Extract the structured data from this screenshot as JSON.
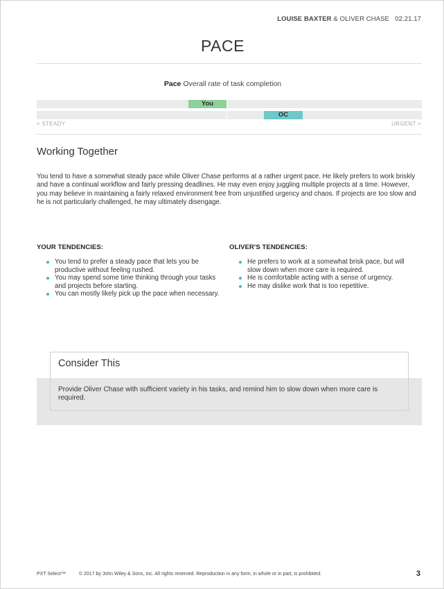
{
  "header": {
    "names_bold": "LOUISE BAXTER",
    "names_rest": "& OLIVER CHASE",
    "date": "02.21.17"
  },
  "page_title": "PACE",
  "scale": {
    "title_strong": "Pace",
    "title_rest": "Overall rate of task completion",
    "markers": [
      {
        "label": "You",
        "color": "#8fd19a"
      },
      {
        "label": "OC",
        "color": "#6ec8c8"
      }
    ],
    "left_label": "< STEADY",
    "right_label": "URGENT >"
  },
  "working_together": {
    "heading": "Working Together",
    "paragraph": "You tend to have a somewhat steady pace while Oliver Chase performs at a rather urgent pace. He likely prefers to work briskly and have a continual workflow and fairly pressing deadlines. He may even enjoy juggling multiple projects at a time. However, you may believe in maintaining a fairly relaxed environment free from unjustified urgency and chaos. If projects are too slow and he is not particularly challenged, he may ultimately disengage."
  },
  "your_tendencies": {
    "heading": "YOUR TENDENCIES:",
    "items": [
      "You tend to prefer a steady pace that lets you be productive without feeling rushed.",
      "You may spend some time thinking through your tasks and projects before starting.",
      "You can mostly likely pick up the pace when necessary."
    ]
  },
  "olivers_tendencies": {
    "heading": "OLIVER'S TENDENCIES:",
    "items": [
      "He prefers to work at a somewhat brisk pace, but will slow down when more care is required.",
      "He is comfortable acting with a sense of urgency.",
      "He may dislike work that is too repetitive."
    ]
  },
  "consider": {
    "title": "Consider This",
    "text": "Provide Oliver Chase with sufficient variety in his tasks, and remind him to slow down when more care is required."
  },
  "footer": {
    "brand": "PXT Select™",
    "copyright": "© 2017 by John Wiley & Sons, Inc. All rights reserved. Reproduction in any form, in whole or in part, is prohibited.",
    "page_number": "3"
  },
  "colors": {
    "you_marker": "#8fd19a",
    "oc_marker": "#6ec8c8",
    "bullet": "#3fb6c4",
    "track": "#ebebeb"
  }
}
